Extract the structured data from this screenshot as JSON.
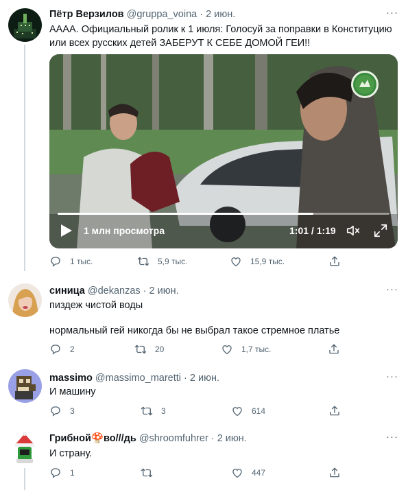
{
  "tweets": [
    {
      "name": "Пётр Верзилов",
      "handle": "@gruppa_voina",
      "dot": "·",
      "date": "2 июн.",
      "text": "АААА. Официальный ролик к 1 июля: Голосуй за поправки в Конституцию или всех русских детей ЗАБЕРУТ К СЕБЕ ДОМОЙ ГЕИ!!",
      "video": {
        "views": "1 млн просмотра",
        "time": "1:01 / 1:19",
        "progress": 0.77
      },
      "replies": "1 тыс.",
      "retweets": "5,9 тыс.",
      "likes": "15,9 тыс."
    },
    {
      "name": "синица",
      "handle": "@dekanzas",
      "dot": "·",
      "date": "2 июн.",
      "text": "пиздеж чистой воды",
      "text2": "нормальный гей никогда бы не выбрал такое стремное платье",
      "replies": "2",
      "retweets": "20",
      "likes": "1,7 тыс."
    },
    {
      "name": "massimo",
      "handle": "@massimo_maretti",
      "dot": "·",
      "date": "2 июн.",
      "text": "И машину",
      "replies": "3",
      "retweets": "3",
      "likes": "614"
    },
    {
      "name_pre": "Грибной",
      "name_emoji": "🍄",
      "name_post": "во///дь",
      "handle": "@shroomfuhrer",
      "dot": "·",
      "date": "2 июн.",
      "text": "И страну.",
      "replies": "1",
      "retweets": "",
      "likes": "447"
    }
  ],
  "ui": {
    "more": "···"
  },
  "icons": {
    "reply": "reply-icon",
    "retweet": "retweet-icon",
    "like": "heart-icon",
    "share": "share-icon",
    "more": "more-icon",
    "play": "play-icon",
    "mute": "mute-icon",
    "fullscreen": "fullscreen-icon"
  },
  "colors": {
    "text": "#0f1419",
    "muted": "#536471",
    "line": "#cfd9de"
  }
}
